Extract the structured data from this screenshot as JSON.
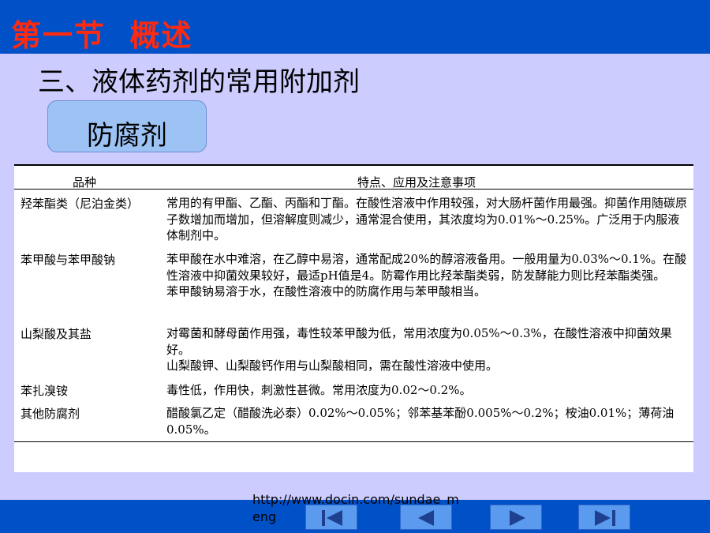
{
  "header": {
    "title": "第一节  概述"
  },
  "section_heading": "三、液体药剂的常用附加剂",
  "category_label": "防腐剂",
  "table": {
    "headers": [
      "品种",
      "特点、应用及注意事项"
    ],
    "rows": [
      {
        "name": "羟苯酯类（尼泊金类）",
        "lines": [
          "常用的有甲酯、乙酯、丙酯和丁酯。在酸性溶液中作用较强，对大肠杆菌作用最强。抑菌作用随碳原子数增加而增加，但溶解度则减少，通常混合使用，其浓度均为0.01%～0.25%。广泛用于内服液体制剂中。"
        ]
      },
      {
        "name": "苯甲酸与苯甲酸钠",
        "lines": [
          "苯甲酸在水中难溶，在乙醇中易溶，通常配成20%的醇溶液备用。一般用量为0.03%～0.1%。在酸性溶液中抑菌效果较好，最适pH值是4。防霉作用比羟苯酯类弱，防发酵能力则比羟苯酯类强。",
          "苯甲酸钠易溶于水，在酸性溶液中的防腐作用与苯甲酸相当。"
        ]
      },
      {
        "name": "山梨酸及其盐",
        "lines": [
          "对霉菌和酵母菌作用强，毒性较苯甲酸为低，常用浓度为0.05%～0.3%，在酸性溶液中抑菌效果好。",
          "山梨酸钾、山梨酸钙作用与山梨酸相同，需在酸性溶液中使用。"
        ]
      },
      {
        "name": "苯扎溴铵",
        "lines": [
          "毒性低，作用快，刺激性甚微。常用浓度为0.02～0.2%。"
        ]
      },
      {
        "name": "其他防腐剂",
        "lines": [
          "醋酸氯乙定（醋酸洗必泰）0.02%～0.05%；邻苯基苯酚0.005%～0.2%；桉油0.01%；薄荷油0.05%。"
        ]
      }
    ]
  },
  "watermark_url": "http://www.docin.com/sundae_meng",
  "nav": {
    "first_icon": "skip-first-icon",
    "prev_icon": "prev-triangle-icon",
    "next_icon": "next-triangle-icon",
    "last_icon": "skip-last-icon"
  },
  "colors": {
    "background": "#CCCCFF",
    "bar": "#0050C8",
    "title_red": "#FF2A10",
    "category_box": "#9DC3F5",
    "nav_button": "#5A9BF0",
    "nav_icon": "#1F3F8F"
  }
}
